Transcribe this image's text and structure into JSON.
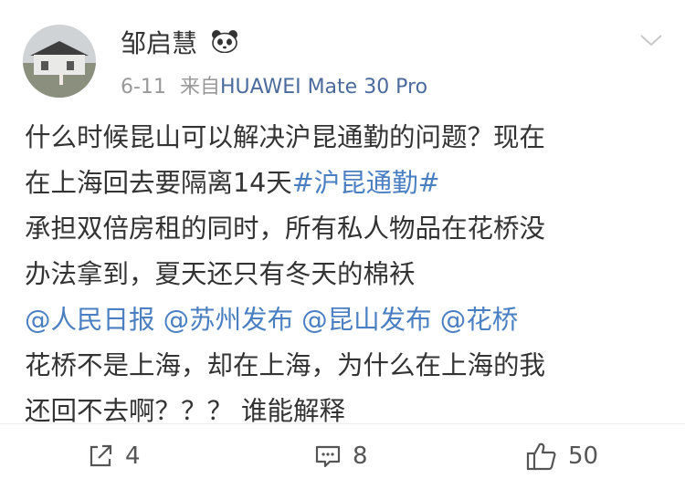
{
  "user": {
    "name": "邹启慧",
    "badge_icon": "panda-icon"
  },
  "post": {
    "date": "6-11",
    "source_prefix": "来自",
    "source_device": "HUAWEI Mate 30 Pro",
    "lines": [
      {
        "text": "什么时候昆山可以解决沪昆通勤的问题？现在"
      },
      {
        "text": "在上海回去要隔离14天",
        "hashtag": "#沪昆通勤#"
      },
      {
        "text": "承担双倍房租的同时，所有私人物品在花桥没"
      },
      {
        "text": "办法拿到，夏天还只有冬天的棉袄"
      },
      {
        "mentions": [
          "@人民日报",
          "@苏州发布",
          "@昆山发布",
          "@花桥"
        ]
      },
      {
        "text": "花桥不是上海，却在上海，为什么在上海的我"
      },
      {
        "text": "还回不去啊？？？ 谁能解释"
      }
    ]
  },
  "actions": {
    "repost_count": "4",
    "comment_count": "8",
    "like_count": "50"
  },
  "colors": {
    "link": "#4a7fc1",
    "meta": "#999999",
    "source": "#4a6b9c"
  }
}
